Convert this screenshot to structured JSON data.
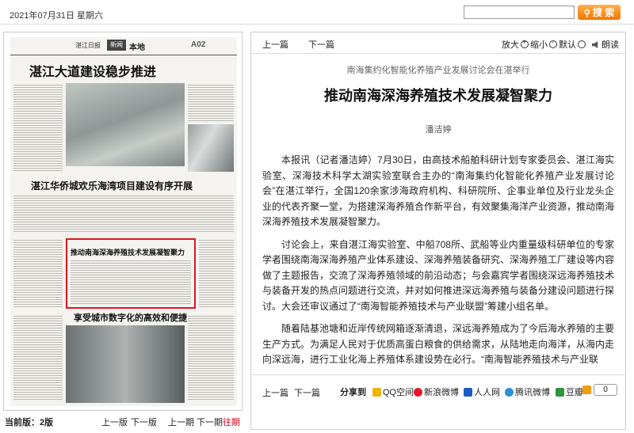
{
  "header": {
    "date": "2021年07月31日 星期六",
    "search_placeholder": "",
    "search_label": "搜 索"
  },
  "paper": {
    "masthead_logo": "湛江日报",
    "section_tag": "新闻",
    "section": "本地",
    "page_no": "A02",
    "headline_1": "湛江大道建设稳步推进",
    "headline_2": "湛江华侨城欢乐海湾项目建设有序开展",
    "headline_3": "享受城市数字化的高效和便捷",
    "highlight_title": "推动南海深海养殖技术发展凝智聚力"
  },
  "left_footer": {
    "current_label": "当前版：",
    "current_value": "2版",
    "prev_page": "上一版",
    "next_page": "下一版",
    "prev_issue": "上一期",
    "next_issue": "下一期",
    "past": "往期"
  },
  "article_toolbar": {
    "prev": "上一篇",
    "next": "下一篇",
    "zoom_in": "放大",
    "zoom_out": "缩小",
    "reset": "默认",
    "read": "朗读"
  },
  "article": {
    "kicker": "南海集约化智能化养殖产业发展讨论会在湛举行",
    "title": "推动南海深海养殖技术发展凝智聚力",
    "author": "潘洁婷",
    "paragraphs": [
      "本报讯（记者潘洁婷）7月30日，由高技术船舶科研计划专家委员会、湛江海实验室、深海技术科学太湖实验室联合主办的“南海集约化智能化养殖产业发展讨论会”在湛江举行，全国120余家涉海政府机构、科研院所、企事业单位及行业龙头企业的代表齐聚一堂，为搭建深海养殖合作新平台，有效聚集海洋产业资源，推动南海深海养殖技术发展凝智聚力。",
      "讨论会上，来自湛江海实验室、中船708所、武船等业内重量级科研单位的专家学者围绕南海深海养殖产业体系建设、深海养殖装备研究、深海养殖工厂建设等内容做了主题报告，交流了深海养殖领域的前沿动态；与会嘉宾学者围绕深远海养殖技术与装备开发的热点问题进行交流，并对如何推进深远海养殖与装备分建设问题进行探讨。大会还审议通过了“南海智能养殖技术与产业联盟”筹建小组名单。",
      "随着陆基池塘和近岸传统网箱逐渐清退，深远海养殖成为了今后海水养殖的主要生产方式。为满足人民对于优质高蛋白粮食的供给需求，从陆地走向海洋，从海内走向深远海，进行工业化海上养殖体系建设势在必行。“南海智能养殖技术与产业联"
    ]
  },
  "share_bar": {
    "prev": "上一篇",
    "next": "下一篇",
    "share_label": "分享到",
    "qq": "QQ空间",
    "sina": "新浪微博",
    "renren": "人人网",
    "tencent": "腾讯微博",
    "douban": "豆瓣",
    "count": "0"
  },
  "colors": {
    "accent_orange": "#f07800",
    "highlight_red": "#e0141e",
    "past_link_red": "#d0021b"
  }
}
